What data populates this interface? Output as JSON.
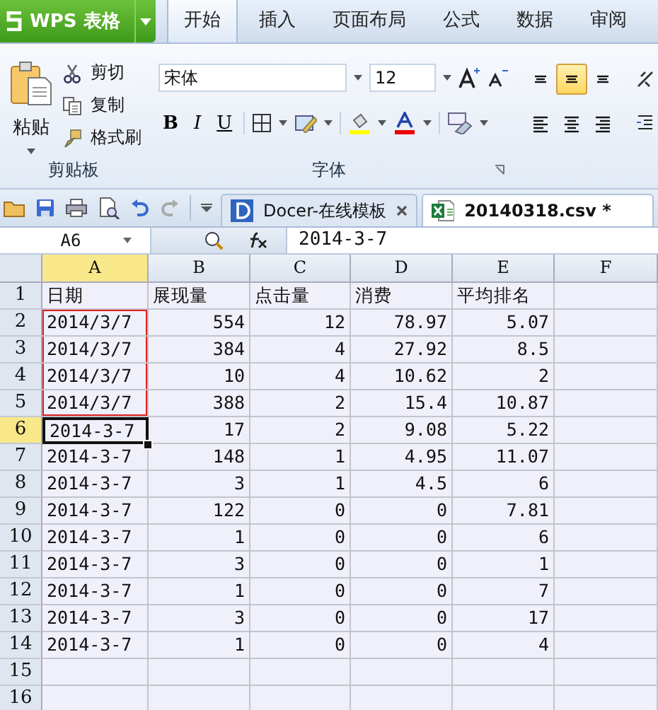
{
  "app_button": {
    "label": "WPS 表格"
  },
  "ribbon_tabs": [
    {
      "label": "开始",
      "selected": true
    },
    {
      "label": "插入",
      "selected": false
    },
    {
      "label": "页面布局",
      "selected": false
    },
    {
      "label": "公式",
      "selected": false
    },
    {
      "label": "数据",
      "selected": false
    },
    {
      "label": "审阅",
      "selected": false
    }
  ],
  "clipboard": {
    "paste": "粘贴",
    "actions": [
      {
        "kind": "cut",
        "label": "剪切"
      },
      {
        "kind": "copy",
        "label": "复制"
      },
      {
        "kind": "format",
        "label": "格式刷"
      }
    ],
    "group_label": "剪贴板"
  },
  "font": {
    "name": "宋体",
    "size": "12",
    "styles": [
      "B",
      "I",
      "U"
    ],
    "group_label": "字体"
  },
  "alignment": [
    {
      "kind": "top",
      "selected": false
    },
    {
      "kind": "middle",
      "selected": true
    },
    {
      "kind": "bottom",
      "selected": false
    },
    {
      "kind": "left",
      "selected": false
    },
    {
      "kind": "center",
      "selected": false
    },
    {
      "kind": "right",
      "selected": false
    }
  ],
  "doc_tabs": [
    {
      "label": "Docer-在线模板",
      "kind": "docer",
      "selected": false
    },
    {
      "label": "20140318.csv *",
      "kind": "sheet",
      "selected": true
    }
  ],
  "name_box": "A6",
  "formula": "2014-3-7",
  "columns": [
    {
      "label": "A",
      "selected": true
    },
    {
      "label": "B",
      "selected": false
    },
    {
      "label": "C",
      "selected": false
    },
    {
      "label": "D",
      "selected": false
    },
    {
      "label": "E",
      "selected": false
    },
    {
      "label": "F",
      "selected": false
    }
  ],
  "rows": [
    {
      "number": "1",
      "selected": false,
      "marked": false,
      "cells": [
        "日期",
        "展现量",
        "点击量",
        "消费",
        "平均排名"
      ]
    },
    {
      "number": "2",
      "selected": false,
      "marked": true,
      "cells": [
        "2014/3/7",
        "554",
        "12",
        "78.97",
        "5.07"
      ]
    },
    {
      "number": "3",
      "selected": false,
      "marked": true,
      "cells": [
        "2014/3/7",
        "384",
        "4",
        "27.92",
        "8.5"
      ]
    },
    {
      "number": "4",
      "selected": false,
      "marked": true,
      "cells": [
        "2014/3/7",
        "10",
        "4",
        "10.62",
        "2"
      ]
    },
    {
      "number": "5",
      "selected": false,
      "marked": true,
      "cells": [
        "2014/3/7",
        "388",
        "2",
        "15.4",
        "10.87"
      ]
    },
    {
      "number": "6",
      "selected": true,
      "marked": false,
      "cells": [
        "2014-3-7",
        "17",
        "2",
        "9.08",
        "5.22"
      ]
    },
    {
      "number": "7",
      "selected": false,
      "marked": false,
      "cells": [
        "2014-3-7",
        "148",
        "1",
        "4.95",
        "11.07"
      ]
    },
    {
      "number": "8",
      "selected": false,
      "marked": false,
      "cells": [
        "2014-3-7",
        "3",
        "1",
        "4.5",
        "6"
      ]
    },
    {
      "number": "9",
      "selected": false,
      "marked": false,
      "cells": [
        "2014-3-7",
        "122",
        "0",
        "0",
        "7.81"
      ]
    },
    {
      "number": "10",
      "selected": false,
      "marked": false,
      "cells": [
        "2014-3-7",
        "1",
        "0",
        "0",
        "6"
      ]
    },
    {
      "number": "11",
      "selected": false,
      "marked": false,
      "cells": [
        "2014-3-7",
        "3",
        "0",
        "0",
        "1"
      ]
    },
    {
      "number": "12",
      "selected": false,
      "marked": false,
      "cells": [
        "2014-3-7",
        "1",
        "0",
        "0",
        "7"
      ]
    },
    {
      "number": "13",
      "selected": false,
      "marked": false,
      "cells": [
        "2014-3-7",
        "3",
        "0",
        "0",
        "17"
      ]
    },
    {
      "number": "14",
      "selected": false,
      "marked": false,
      "cells": [
        "2014-3-7",
        "1",
        "0",
        "0",
        "4"
      ]
    },
    {
      "number": "15",
      "selected": false,
      "marked": false,
      "cells": []
    },
    {
      "number": "16",
      "selected": false,
      "marked": false,
      "cells": []
    }
  ]
}
